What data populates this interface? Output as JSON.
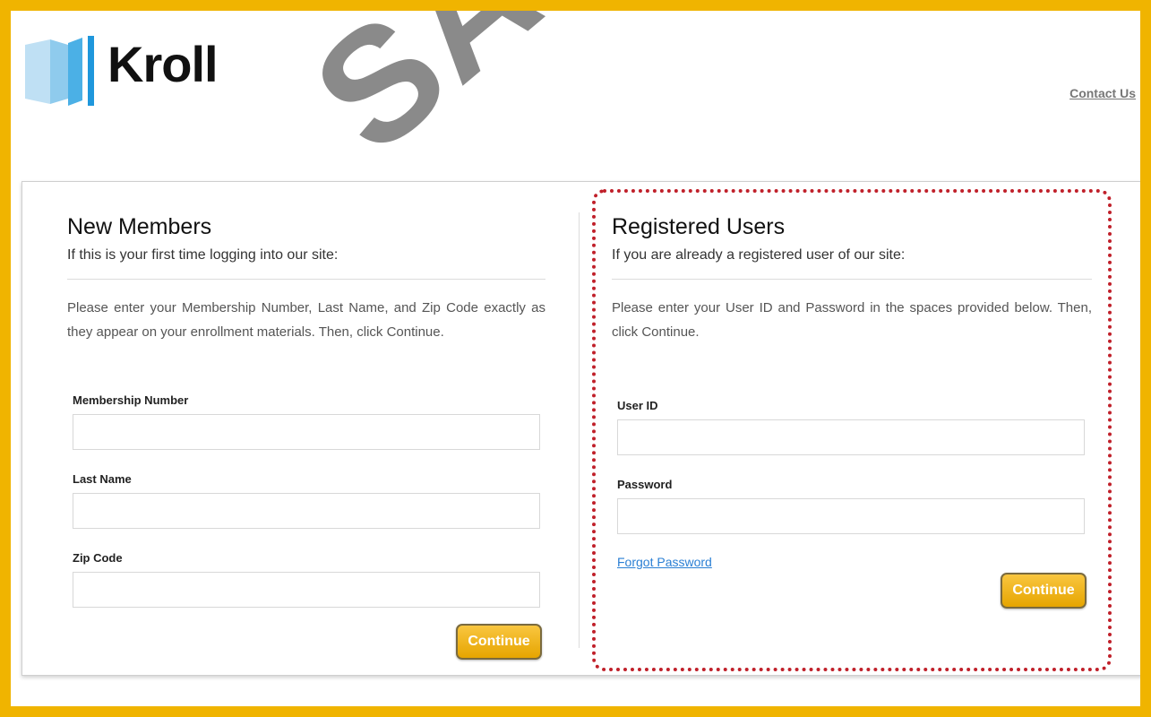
{
  "header": {
    "logo_text": "Kroll",
    "contact_label": "Contact Us"
  },
  "new_members": {
    "title": "New Members",
    "subtitle": "If this is your first time logging into our site:",
    "description": "Please enter your Membership Number, Last Name, and Zip Code exactly as they appear on your enrollment materials. Then, click Continue.",
    "fields": [
      {
        "label": "Membership Number",
        "value": ""
      },
      {
        "label": "Last Name",
        "value": ""
      },
      {
        "label": "Zip Code",
        "value": ""
      }
    ],
    "continue_label": "Continue"
  },
  "registered_users": {
    "title": "Registered Users",
    "subtitle": "If you are already a registered user of our site:",
    "description": "Please enter your User ID and Password in the spaces provided below. Then, click Continue.",
    "fields": [
      {
        "label": "User ID",
        "value": ""
      },
      {
        "label": "Password",
        "value": ""
      }
    ],
    "forgot_label": "Forgot Password",
    "continue_label": "Continue"
  },
  "watermark": "SAMPLE",
  "colors": {
    "frame": "#f0b400",
    "button": "#f0b400",
    "link": "#2a7fd4",
    "highlight": "#c0202a"
  }
}
